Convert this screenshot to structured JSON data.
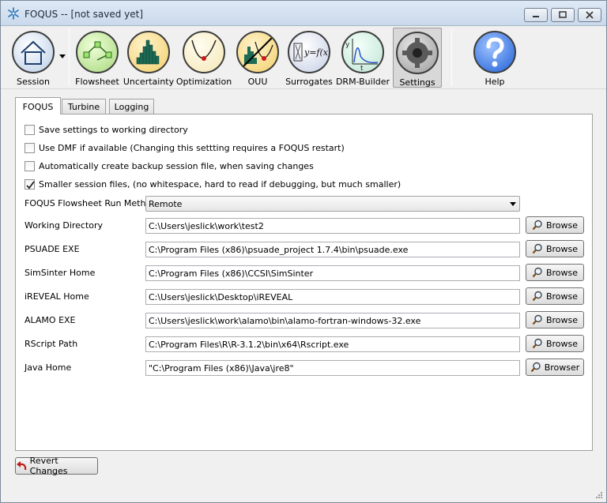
{
  "window": {
    "title": "FOQUS -- [not saved yet]"
  },
  "toolbar": {
    "items": [
      {
        "label": "Session",
        "icon": "home-icon"
      },
      {
        "label": "Flowsheet",
        "icon": "flowsheet-icon"
      },
      {
        "label": "Uncertainty",
        "icon": "histogram-icon"
      },
      {
        "label": "Optimization",
        "icon": "optimization-curve-icon"
      },
      {
        "label": "OUU",
        "icon": "ouu-icon"
      },
      {
        "label": "Surrogates",
        "icon": "surrogates-icon"
      },
      {
        "label": "DRM-Builder",
        "icon": "drm-builder-icon"
      },
      {
        "label": "Settings",
        "icon": "gear-icon",
        "active": true
      },
      {
        "label": "Help",
        "icon": "question-icon"
      }
    ]
  },
  "tabs": [
    {
      "label": "FOQUS",
      "active": true
    },
    {
      "label": "Turbine"
    },
    {
      "label": "Logging"
    }
  ],
  "settings": {
    "checkboxes": [
      {
        "label": "Save settings to working directory",
        "checked": false
      },
      {
        "label": "Use DMF if available (Changing this settting requires a FOQUS restart)",
        "checked": false
      },
      {
        "label": "Automatically create backup session file, when saving changes",
        "checked": false
      },
      {
        "label": "Smaller session files, (no whitespace, hard to read if debugging, but much smaller)",
        "checked": true
      }
    ],
    "run_method": {
      "label": "FOQUS Flowsheet Run Method",
      "value": "Remote"
    },
    "paths": [
      {
        "label": "Working Directory",
        "value": "C:\\Users\\jeslick\\work\\test2",
        "button": "Browse"
      },
      {
        "label": "PSUADE EXE",
        "value": "C:\\Program Files (x86)\\psuade_project 1.7.4\\bin\\psuade.exe",
        "button": "Browse"
      },
      {
        "label": "SimSinter Home",
        "value": "C:\\Program Files (x86)\\CCSI\\SimSinter",
        "button": "Browse"
      },
      {
        "label": "iREVEAL Home",
        "value": "C:\\Users\\jeslick\\Desktop\\iREVEAL",
        "button": "Browse"
      },
      {
        "label": "ALAMO EXE",
        "value": "C:\\Users\\jeslick\\work\\alamo\\bin\\alamo-fortran-windows-32.exe",
        "button": "Browse"
      },
      {
        "label": "RScript Path",
        "value": "C:\\Program Files\\R\\R-3.1.2\\bin\\x64\\Rscript.exe",
        "button": "Browse"
      },
      {
        "label": "Java Home",
        "value": "\"C:\\Program Files (x86)\\Java\\jre8\"",
        "button": "Browser"
      }
    ]
  },
  "footer": {
    "revert_label": "Revert Changes"
  }
}
